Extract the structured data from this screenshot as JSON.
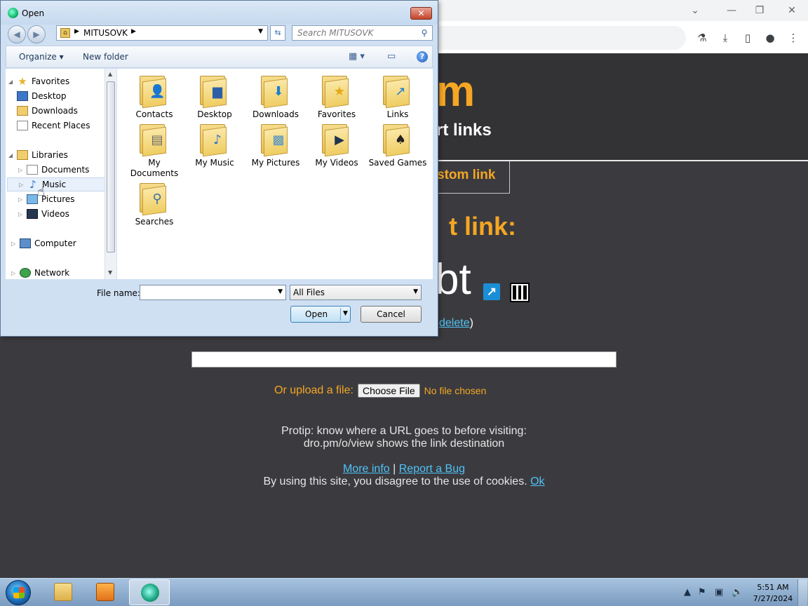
{
  "browser": {
    "window_controls": {
      "chevron": "⌄",
      "minimize": "—",
      "restore": "❐",
      "close": "✕"
    },
    "toolbar_icons": {
      "labs": "⚗",
      "download": "⤓",
      "sidepanel": "▯",
      "profile": "●",
      "menu": "⋮"
    }
  },
  "page": {
    "logo_fragment": "m",
    "tagline_fragment": "rt links",
    "custom_link_fragment": "stom link",
    "short_link_heading_fragment": "t link:",
    "short_code_fragment": "bt",
    "delete_link": "delete",
    "delete_suffix": ")",
    "upload_label": "Or upload a file:",
    "choose_file": "Choose File",
    "no_file": "No file chosen",
    "protip_line1": "Protip: know where a URL goes to before visiting:",
    "protip_line2": "dro.pm/o/view shows the link destination",
    "more_info": "More info",
    "separator": "|",
    "report_bug": "Report a Bug",
    "cookies_text": "By using this site, you disagree to the use of cookies.",
    "ok": "Ok"
  },
  "dialog": {
    "title": "Open",
    "close": "✕",
    "back": "◀",
    "forward": "▶",
    "breadcrumb": "MITUSOVK",
    "search_placeholder": "Search MITUSOVK",
    "organize": "Organize ▾",
    "new_folder": "New folder",
    "view_icon": "▦ ▾",
    "preview_icon": "▭",
    "help": "?",
    "tree": [
      {
        "label": "Favorites",
        "group": true
      },
      {
        "label": "Desktop"
      },
      {
        "label": "Downloads"
      },
      {
        "label": "Recent Places"
      },
      {
        "label": "Libraries",
        "group": true
      },
      {
        "label": "Documents"
      },
      {
        "label": "Music",
        "selected": true
      },
      {
        "label": "Pictures"
      },
      {
        "label": "Videos"
      },
      {
        "label": "Computer"
      },
      {
        "label": "Network"
      }
    ],
    "folders": [
      {
        "name": "Contacts",
        "glyph": "👤"
      },
      {
        "name": "Desktop",
        "glyph": "▆"
      },
      {
        "name": "Downloads",
        "glyph": "⬇"
      },
      {
        "name": "Favorites",
        "glyph": "★"
      },
      {
        "name": "Links",
        "glyph": "↗"
      },
      {
        "name": "My Documents",
        "glyph": "▤"
      },
      {
        "name": "My Music",
        "glyph": "♪"
      },
      {
        "name": "My Pictures",
        "glyph": "▩"
      },
      {
        "name": "My Videos",
        "glyph": "▶"
      },
      {
        "name": "Saved Games",
        "glyph": "♠"
      },
      {
        "name": "Searches",
        "glyph": "⚲"
      }
    ],
    "file_name_label": "File name:",
    "file_name_value": "",
    "filter": "All Files",
    "open": "Open",
    "cancel": "Cancel"
  },
  "taskbar": {
    "time": "5:51 AM",
    "date": "7/27/2024"
  }
}
